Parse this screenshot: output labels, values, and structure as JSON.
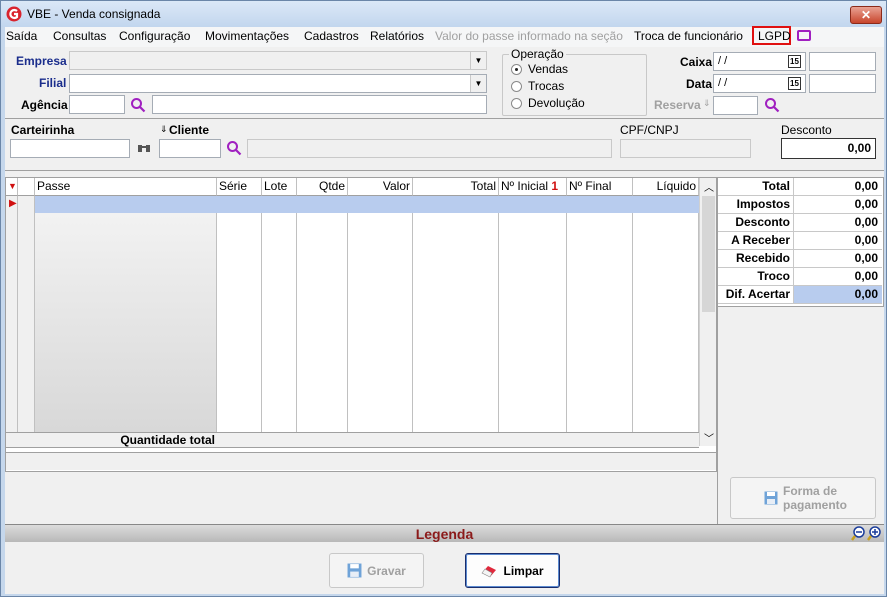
{
  "window": {
    "title": "VBE - Venda consignada",
    "close_glyph": "✕"
  },
  "menu": {
    "items": [
      "Saída",
      "Consultas",
      "Configuração",
      "Movimentações",
      "Cadastros",
      "Relatórios",
      "Valor do passe informado na seção",
      "Troca de funcionário",
      "LGPD"
    ]
  },
  "form": {
    "empresa_label": "Empresa",
    "filial_label": "Filial",
    "agencia_label": "Agência",
    "operacao": {
      "legend": "Operação",
      "options": [
        "Vendas",
        "Trocas",
        "Devolução"
      ],
      "selected": "Vendas"
    },
    "caixa_label": "Caixa",
    "data_label": "Data",
    "reserva_label": "Reserva",
    "date_placeholder": " / /",
    "calendar_glyph": "15",
    "carteirinha_label": "Carteirinha",
    "cliente_label": "Cliente",
    "cpf_label": "CPF/CNPJ",
    "desconto_label": "Desconto",
    "desconto_value": "0,00"
  },
  "grid": {
    "columns": [
      "Passe",
      "Série",
      "Lote",
      "Qtde",
      "Valor",
      "Total",
      "Nº Inicial",
      "Nº Final",
      "Líquido"
    ],
    "sort_indicator": "1",
    "quantity_label": "Quantidade total"
  },
  "totals": [
    {
      "label": "Total",
      "value": "0,00"
    },
    {
      "label": "Impostos",
      "value": "0,00"
    },
    {
      "label": "Desconto",
      "value": "0,00"
    },
    {
      "label": "A Receber",
      "value": "0,00"
    },
    {
      "label": "Recebido",
      "value": "0,00"
    },
    {
      "label": "Troco",
      "value": "0,00"
    },
    {
      "label": "Dif. Acertar",
      "value": "0,00"
    }
  ],
  "payment_button": {
    "line1": "Forma de",
    "line2": "pagamento"
  },
  "legend_bar": {
    "label": "Legenda"
  },
  "buttons": {
    "save": "Gravar",
    "clear": "Limpar"
  },
  "colors": {
    "accent_red": "#e01010",
    "legend_text": "#8b1a1a",
    "selection": "#b8ccee",
    "search_icon": "#a020c0"
  }
}
